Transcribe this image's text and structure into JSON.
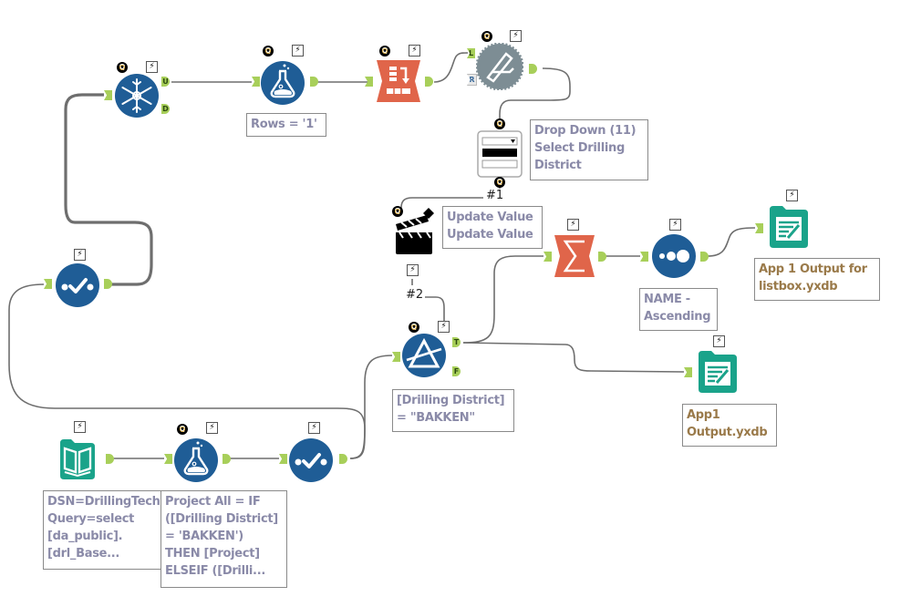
{
  "canvas": {
    "background": "#ffffff",
    "colors": {
      "tool_blue": "#1f5d96",
      "tool_orange": "#e0654a",
      "tool_teal": "#1aa38a",
      "tool_gray": "#7d8d94",
      "anchor_green": "#a8cf5a",
      "wire": "#6e6e6e",
      "annotation_text": "#8a8aa8"
    }
  },
  "tools": [
    {
      "id": "dynamic-input",
      "icon": "snowflake-icon",
      "anchors": {
        "out": [
          "U",
          "D"
        ]
      }
    },
    {
      "id": "formula-rows",
      "icon": "flask-icon",
      "annotation": [
        "Rows = '1'"
      ]
    },
    {
      "id": "crosstab",
      "icon": "crosstab-icon"
    },
    {
      "id": "append-fields",
      "icon": "pen-icon",
      "anchors": {
        "in": [
          "L",
          "R"
        ]
      }
    },
    {
      "id": "dropdown",
      "icon": "dropdown-interface-icon",
      "annotation": [
        "Drop Down (11)",
        "Select Drilling",
        "District"
      ]
    },
    {
      "id": "action",
      "icon": "clapperboard-icon",
      "annotation": [
        "Update Value",
        "Update Value"
      ]
    },
    {
      "id": "filter",
      "icon": "filter-prism-icon",
      "annotation": [
        "[Drilling District]",
        "= \"BAKKEN\""
      ],
      "anchors": {
        "out": [
          "T",
          "F"
        ]
      }
    },
    {
      "id": "summarize",
      "icon": "sigma-icon"
    },
    {
      "id": "sort",
      "icon": "sort-dots-icon",
      "annotation": [
        "NAME -",
        "Ascending"
      ]
    },
    {
      "id": "output-listbox",
      "icon": "output-file-icon",
      "annotation": [
        "App 1 Output for",
        "listbox.yxdb"
      ]
    },
    {
      "id": "output-app1",
      "icon": "output-file-icon",
      "annotation": [
        "App1",
        "Output.yxdb"
      ]
    },
    {
      "id": "input-db",
      "icon": "book-input-icon",
      "annotation": [
        "DSN=DrillingTech",
        "Query=select",
        "[da_public].",
        "[drl_Base..."
      ]
    },
    {
      "id": "formula-project",
      "icon": "flask-icon",
      "annotation": [
        "Project All = IF",
        "([Drilling District]",
        "= 'BAKKEN')",
        "THEN [Project]",
        "ELSEIF ([Drilli..."
      ]
    },
    {
      "id": "select-bottom",
      "icon": "select-check-icon"
    },
    {
      "id": "select-left",
      "icon": "select-check-icon"
    }
  ],
  "labels": {
    "step1": "#1",
    "step2": "#2",
    "q": "Q",
    "bolt": "⚡"
  }
}
